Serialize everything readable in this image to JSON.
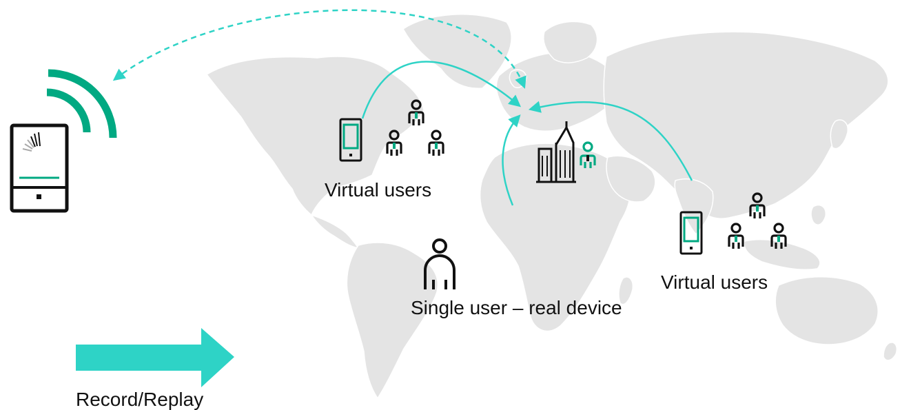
{
  "labels": {
    "virtual_users_americas": "Virtual users",
    "virtual_users_asia": "Virtual users",
    "single_user": "Single user – real device",
    "bottom_left": "Record/Replay"
  },
  "colors": {
    "accent": "#2ed3c6",
    "accent_green": "#01a982",
    "map_land": "#e4e4e4",
    "map_border": "#ffffff",
    "icon_stroke": "#111111"
  },
  "icons": [
    "mobile-phone-icon",
    "wifi-signal-icon",
    "tablet-icon",
    "user-group-icon",
    "city-building-icon",
    "single-user-icon",
    "right-arrow-icon"
  ]
}
